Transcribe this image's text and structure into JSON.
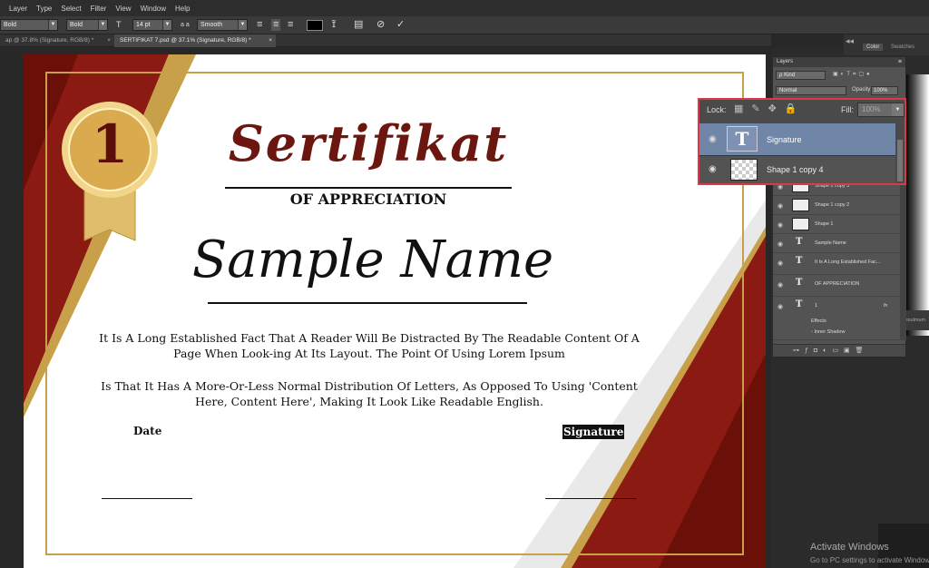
{
  "menu": [
    "Layer",
    "Type",
    "Select",
    "Filter",
    "View",
    "Window",
    "Help"
  ],
  "options": {
    "font_style_1": "Bold",
    "font_style_2": "Bold",
    "size_prefix": "T",
    "font_size": "14 pt",
    "aa_prefix": "a a",
    "antialias": "Smooth"
  },
  "tabs": [
    {
      "label": "ap @ 37.8% (Signature, RGB/8) *"
    },
    {
      "label": "SERTIFIKAT 7.psd @ 37.1% (Signature, RGB/8) *"
    }
  ],
  "certificate": {
    "badge_number": "1",
    "title": "Sertifikat",
    "subtitle": "OF APPRECIATION",
    "name": "Sample Name",
    "paragraph1": "It Is A Long Established Fact That A Reader Will Be Distracted By The Readable Content Of A Page When Look-ing At Its Layout. The Point Of Using Lorem Ipsum",
    "paragraph2": "Is That It Has A More-Or-Less Normal Distribution Of Letters, As Opposed To Using 'Content Here, Content Here', Making It Look Like Readable English.",
    "date_label": "Date",
    "signature_label": "Signature"
  },
  "panel_tabs": [
    "Color",
    "Swatches"
  ],
  "layers_panel": {
    "title": "Layers",
    "kind": "Kind",
    "blend_mode": "Normal",
    "opacity_label": "Opacity:",
    "opacity_value": "100%",
    "lock_label": "Lock:",
    "fill_label": "Fill:",
    "fill_value": "100%",
    "layers": [
      {
        "name": "Signature",
        "type": "text"
      },
      {
        "name": "Shape 1 copy 4",
        "type": "shape"
      },
      {
        "name": "Shape 1 copy 3",
        "type": "shape"
      },
      {
        "name": "Shape 1 copy 2",
        "type": "shape"
      },
      {
        "name": "Shape 1",
        "type": "shape"
      },
      {
        "name": "Sample Name",
        "type": "text"
      },
      {
        "name": "It Is A Long Established Fac...",
        "type": "text"
      },
      {
        "name": "OF APPRECIATION",
        "type": "text"
      },
      {
        "name": "1",
        "type": "text"
      }
    ],
    "effects_label": "Effects",
    "effect_item": "Inner Shadow",
    "fx_label": "fx"
  },
  "zoom_overlay": {
    "lock_label": "Lock:",
    "fill_label": "Fill:",
    "fill_value": "100%",
    "rows": [
      {
        "name": "Signature",
        "selected": true
      },
      {
        "name": "Shape 1 copy 4",
        "selected": false
      }
    ]
  },
  "watermark": {
    "line1": "Activate Windows",
    "line2": "Go to PC settings to activate Windows."
  },
  "side_fragment": "resulmum",
  "colors": {
    "maroon": "#8b1a12",
    "gold": "#c9a04a",
    "selection_outline": "#d83a4b",
    "selected_row": "#6f86a8"
  }
}
